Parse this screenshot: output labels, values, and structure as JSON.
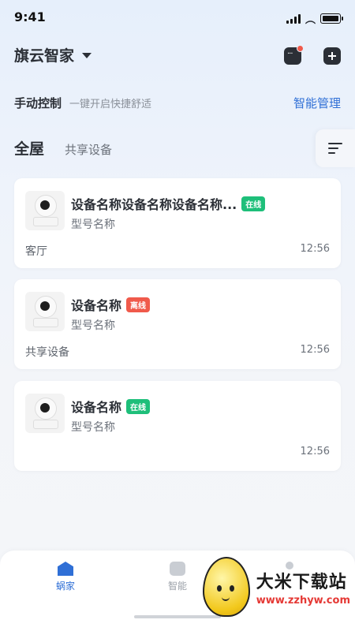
{
  "status": {
    "time": "9:41"
  },
  "header": {
    "home_name": "旗云智家"
  },
  "manual": {
    "title": "手动控制",
    "subtitle": "一键开启快捷舒适",
    "link": "智能管理"
  },
  "tabs": {
    "all": "全屋",
    "shared": "共享设备"
  },
  "devices": [
    {
      "name": "设备名称设备名称设备名称...",
      "status": "在线",
      "model": "型号名称",
      "room": "客厅",
      "time": "12:56"
    },
    {
      "name": "设备名称",
      "status": "离线",
      "model": "型号名称",
      "room": "共享设备",
      "time": "12:56"
    },
    {
      "name": "设备名称",
      "status": "在线",
      "model": "型号名称",
      "room": "",
      "time": "12:56"
    }
  ],
  "nav": {
    "home": "蜗家",
    "smart": "智能"
  },
  "watermark": {
    "name": "大米下载站",
    "url": "www.zzhyw.com"
  },
  "colors": {
    "accent": "#2f6fd6",
    "online": "#1ebf7a",
    "offline": "#f05a4b"
  }
}
